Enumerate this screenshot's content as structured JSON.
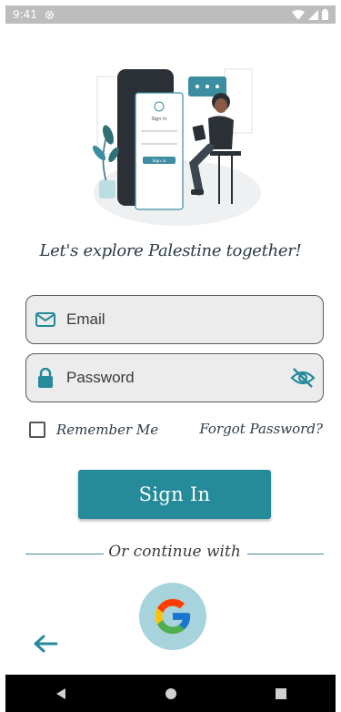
{
  "status_bar": {
    "time": "9:41",
    "icons": [
      "gear-icon",
      "wifi-icon",
      "signal-icon",
      "battery-icon"
    ]
  },
  "illustration": {
    "phone_title": "Sign in",
    "phone_button": "Sign in"
  },
  "tagline": "Let's explore Palestine together!",
  "email_field": {
    "placeholder": "Email",
    "icon": "mail-icon"
  },
  "password_field": {
    "placeholder": "Password",
    "icon": "lock-icon",
    "toggle_icon": "eye-off-icon"
  },
  "remember_me": {
    "label": "Remember Me",
    "checked": false
  },
  "forgot_password": "Forgot Password?",
  "sign_in_button": "Sign In",
  "divider_text": "Or continue with",
  "social": {
    "google_icon": "google-icon"
  },
  "colors": {
    "accent": "#258a9a",
    "google_bg": "#a7d4dc",
    "field_bg": "#ececec",
    "text_dark": "#2d3b48"
  }
}
